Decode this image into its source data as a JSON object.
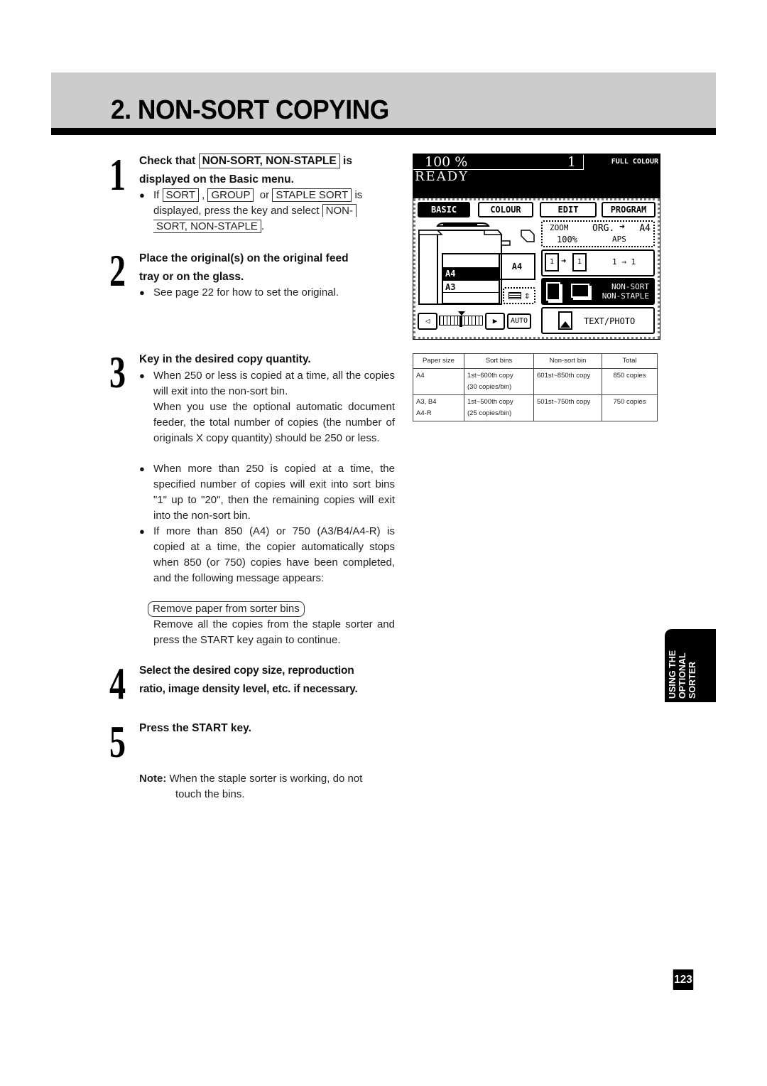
{
  "header": {
    "title": "2. NON-SORT COPYING"
  },
  "steps": [
    {
      "number": "1",
      "title_pre": "Check that",
      "title_key": "NON-SORT, NON-STAPLE",
      "title_post": "is",
      "title_line2": "displayed on the Basic menu.",
      "bullet": {
        "pre": "If",
        "key1": "SORT",
        "sep1": ",",
        "key2": "GROUP",
        "sep2": "or",
        "key3": "STAPLE SORT",
        "post": "is",
        "line2": "displayed, press the key and select",
        "key4a": "NON-",
        "key4b": "SORT, NON-STAPLE",
        "end": "."
      }
    },
    {
      "number": "2",
      "title_line1": "Place the original(s) on the original feed",
      "title_line2": "tray or on the glass.",
      "bullet": "See page 22 for how to set the original."
    },
    {
      "number": "3",
      "title": "Key in the desired copy quantity.",
      "bullets": [
        "When 250 or less is copied at a time, all the copies will exit into the non-sort bin.",
        "When more than 250 is copied at a time, the specified number of copies will exit into sort bins \"1\" up to \"20\", then the remaining copies will exit into the non-sort bin.",
        "If more than 850 (A4) or 750 (A3/B4/A4-R) is copied at a time, the copier automatically stops when 850 (or 750) copies have been completed, and the following message appears:"
      ],
      "adf_note": "When you use the optional automatic document feeder, the total number of copies (the number of originals X copy quantity) should be 250 or less.",
      "message": "Remove paper from sorter bins",
      "message_followup": "Remove all the copies from the staple sorter and press the START key again to continue."
    },
    {
      "number": "4",
      "title_line1": "Select the desired copy size, reproduction",
      "title_line2": "ratio, image density level, etc. if necessary."
    },
    {
      "number": "5",
      "title": "Press the START key."
    }
  ],
  "note": {
    "label": "Note:",
    "text_line1": "When the staple sorter is working, do not",
    "text_line2": "touch the bins."
  },
  "panel": {
    "zoom_readout": "100  %",
    "copy_quantity": "1",
    "colour_mode": "FULL COLOUR",
    "status": "READY",
    "tabs": [
      {
        "label": "BASIC",
        "active": true
      },
      {
        "label": "COLOUR",
        "active": false
      },
      {
        "label": "EDIT",
        "active": false
      },
      {
        "label": "PROGRAM",
        "active": false
      }
    ],
    "trays": [
      {
        "label": "",
        "selected": false
      },
      {
        "label": "A4",
        "selected": true
      },
      {
        "label": "A3",
        "selected": false
      },
      {
        "label": "",
        "selected": false
      }
    ],
    "bypass_size": "A4",
    "auto_label": "AUTO",
    "zoom_button": {
      "label": "ZOOM",
      "value": "100%",
      "org_label": "ORG.",
      "org_size": "A4",
      "aps": "APS"
    },
    "duplex_button": {
      "label": "1 → 1"
    },
    "finisher_button": {
      "line1": "NON-SORT",
      "line2": "NON-STAPLE"
    },
    "image_mode_button": {
      "label": "TEXT/PHOTO"
    },
    "density_level": 0.5
  },
  "table": {
    "headers": [
      "Paper size",
      "Sort bins",
      "Non-sort bin",
      "Total"
    ],
    "rows": [
      {
        "paper": [
          "A4",
          ""
        ],
        "sort": [
          "1st~600th copy",
          "(30 copies/bin)"
        ],
        "nonsort": "601st~850th copy",
        "total": "850 copies"
      },
      {
        "paper": [
          "A3, B4",
          "A4-R"
        ],
        "sort": [
          "1st~500th copy",
          "(25 copies/bin)"
        ],
        "nonsort": "501st~750th copy",
        "total": "750 copies"
      }
    ]
  },
  "side_tab": {
    "line1": "USING THE",
    "line2": "OPTIONAL",
    "line3": "SORTER"
  },
  "page_number": "123"
}
